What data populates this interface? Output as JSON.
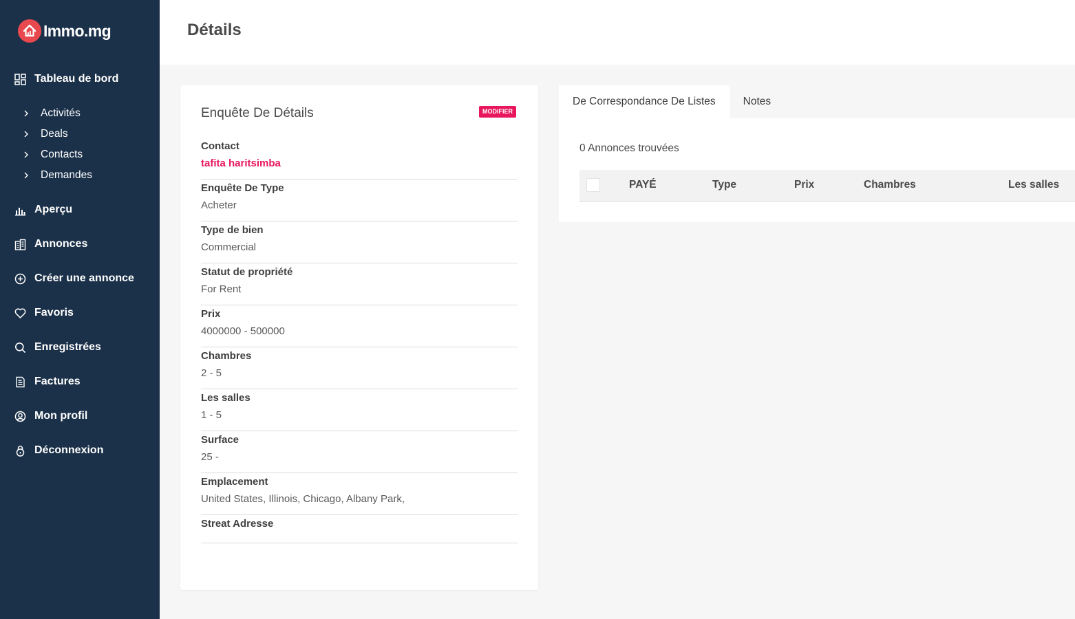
{
  "brand": {
    "name": "Immo.mg",
    "color": "#e8484e"
  },
  "sidebar": {
    "dashboard": {
      "label": "Tableau de bord",
      "icon": "dashboard-icon"
    },
    "sub_items": [
      {
        "label": "Activités"
      },
      {
        "label": "Deals"
      },
      {
        "label": "Contacts"
      },
      {
        "label": "Demandes"
      }
    ],
    "items": [
      {
        "label": "Aperçu",
        "icon": "bar-chart-icon"
      },
      {
        "label": "Annonces",
        "icon": "building-icon"
      },
      {
        "label": "Créer une annonce",
        "icon": "plus-circle-icon"
      },
      {
        "label": "Favoris",
        "icon": "heart-icon"
      },
      {
        "label": "Enregistrées",
        "icon": "search-icon"
      },
      {
        "label": "Factures",
        "icon": "invoice-icon"
      },
      {
        "label": "Mon profil",
        "icon": "user-circle-icon"
      },
      {
        "label": "Déconnexion",
        "icon": "lock-icon"
      }
    ]
  },
  "header": {
    "title": "Détails"
  },
  "details": {
    "title": "Enquête De Détails",
    "edit_label": "MODIFIER",
    "fields": [
      {
        "label": "Contact",
        "value": "tafita haritsimba"
      },
      {
        "label": "Enquête De Type",
        "value": "Acheter"
      },
      {
        "label": "Type de bien",
        "value": "Commercial"
      },
      {
        "label": "Statut de propriété",
        "value": "For Rent"
      },
      {
        "label": "Prix",
        "value": "4000000 - 500000"
      },
      {
        "label": "Chambres",
        "value": "2 - 5"
      },
      {
        "label": "Les salles",
        "value": "1 - 5"
      },
      {
        "label": "Surface",
        "value": "25 -"
      },
      {
        "label": "Emplacement",
        "value": "United States, Illinois, Chicago, Albany Park,"
      },
      {
        "label": "Streat Adresse",
        "value": ""
      }
    ]
  },
  "listings": {
    "tabs": [
      {
        "label": "De Correspondance De Listes"
      },
      {
        "label": "Notes"
      }
    ],
    "found_text": "0 Annonces trouvées",
    "columns": [
      "PAYÉ",
      "Type",
      "Prix",
      "Chambres",
      "Les salles"
    ]
  },
  "colors": {
    "sidebar": "#1b3149",
    "accent": "#e8175d"
  }
}
